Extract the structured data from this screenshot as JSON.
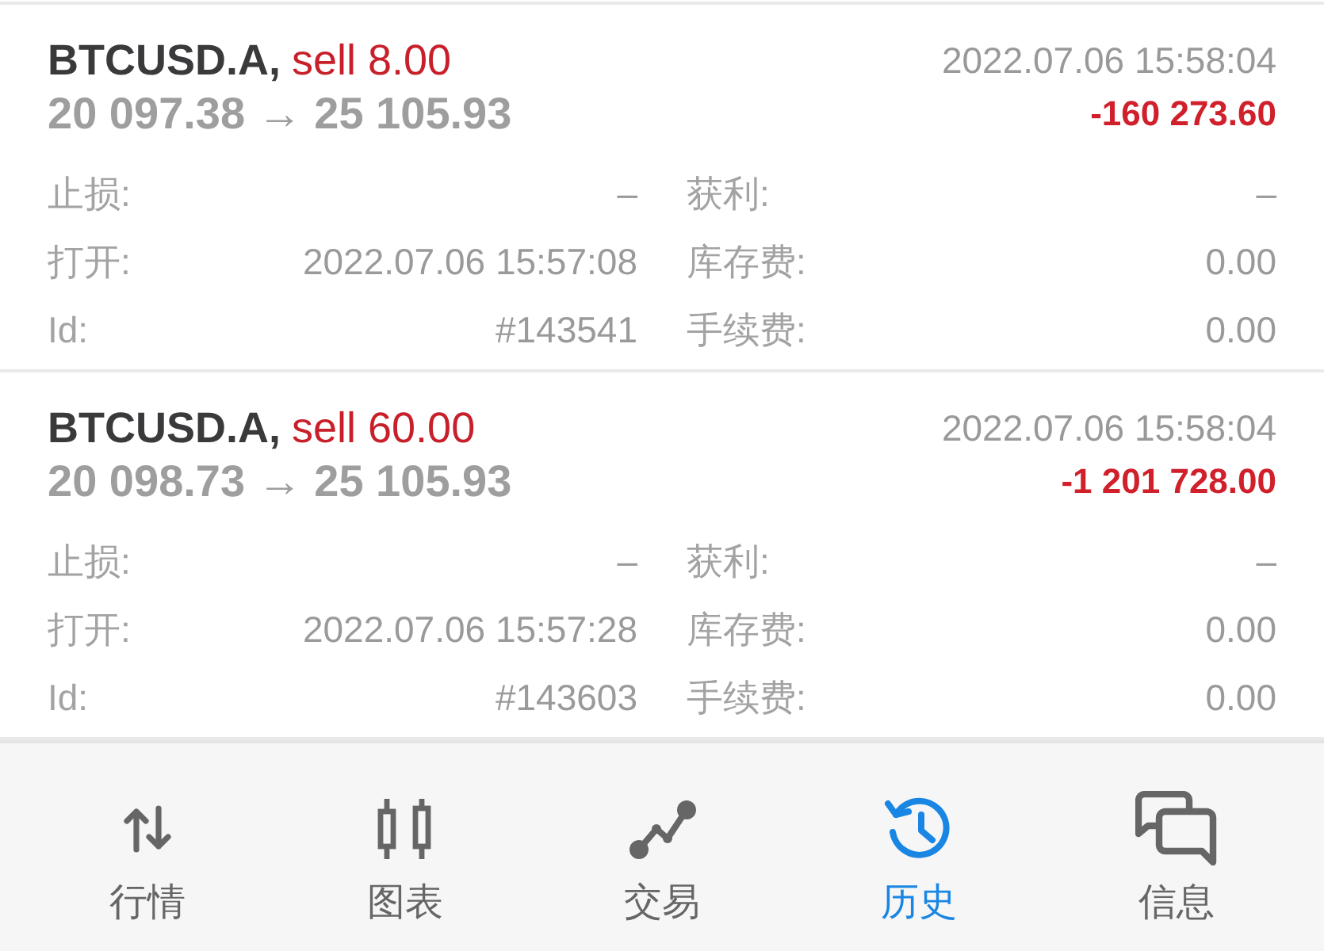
{
  "trades": [
    {
      "symbol": "BTCUSD.A,",
      "side": "sell 8.00",
      "prices": "20 097.38 → 25 105.93",
      "close_time": "2022.07.06 15:58:04",
      "profit": "-160 273.60",
      "fields": [
        {
          "label": "止损:",
          "value": "–"
        },
        {
          "label": "获利:",
          "value": "–"
        },
        {
          "label": "打开:",
          "value": "2022.07.06 15:57:08"
        },
        {
          "label": "库存费:",
          "value": "0.00"
        },
        {
          "label": "Id:",
          "value": "#143541"
        },
        {
          "label": "手续费:",
          "value": "0.00"
        }
      ]
    },
    {
      "symbol": "BTCUSD.A,",
      "side": "sell 60.00",
      "prices": "20 098.73 → 25 105.93",
      "close_time": "2022.07.06 15:58:04",
      "profit": "-1 201 728.00",
      "fields": [
        {
          "label": "止损:",
          "value": "–"
        },
        {
          "label": "获利:",
          "value": "–"
        },
        {
          "label": "打开:",
          "value": "2022.07.06 15:57:28"
        },
        {
          "label": "库存费:",
          "value": "0.00"
        },
        {
          "label": "Id:",
          "value": "#143603"
        },
        {
          "label": "手续费:",
          "value": "0.00"
        }
      ]
    }
  ],
  "nav": [
    {
      "label": "行情",
      "selected": false
    },
    {
      "label": "图表",
      "selected": false
    },
    {
      "label": "交易",
      "selected": false
    },
    {
      "label": "历史",
      "selected": true
    },
    {
      "label": "信息",
      "selected": false
    }
  ]
}
